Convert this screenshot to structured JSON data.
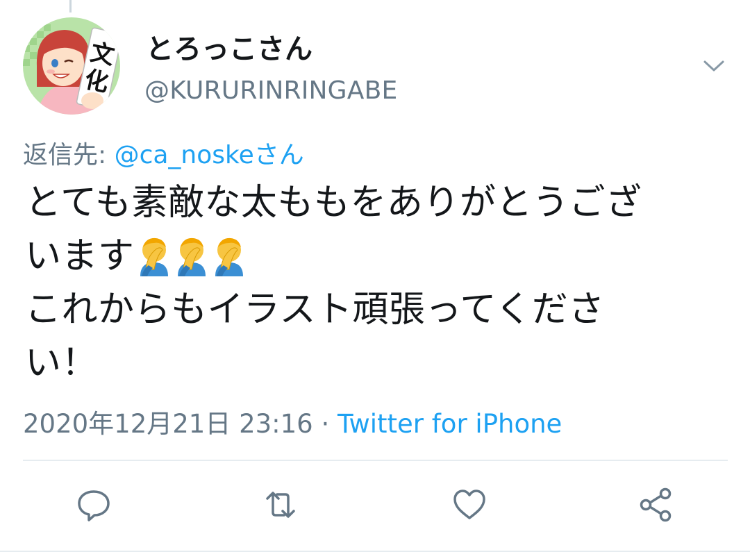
{
  "tweet": {
    "display_name": "とろっこさん",
    "handle": "@KURURINRINGABE",
    "reply_prefix": "返信先: ",
    "reply_mention": "@ca_noskeさん",
    "text_line1": "とても素敵な太ももをありがとうござ",
    "text_line2": "います",
    "text_line3": "これからもイラスト頑張ってくださ",
    "text_line4": "い！",
    "emoji": [
      "face-palm-emoji",
      "face-palm-emoji",
      "face-palm-emoji"
    ],
    "timestamp": "2020年12月21日 23:16",
    "separator": " · ",
    "source": "Twitter for iPhone"
  },
  "avatar": {
    "sign_text": "文化"
  },
  "actions": {
    "icons": [
      "reply-icon",
      "retweet-icon",
      "like-icon",
      "share-icon"
    ]
  },
  "colors": {
    "text": "#14171a",
    "secondary": "#657786",
    "link": "#1da1f2",
    "divider": "#e6ecf0"
  }
}
